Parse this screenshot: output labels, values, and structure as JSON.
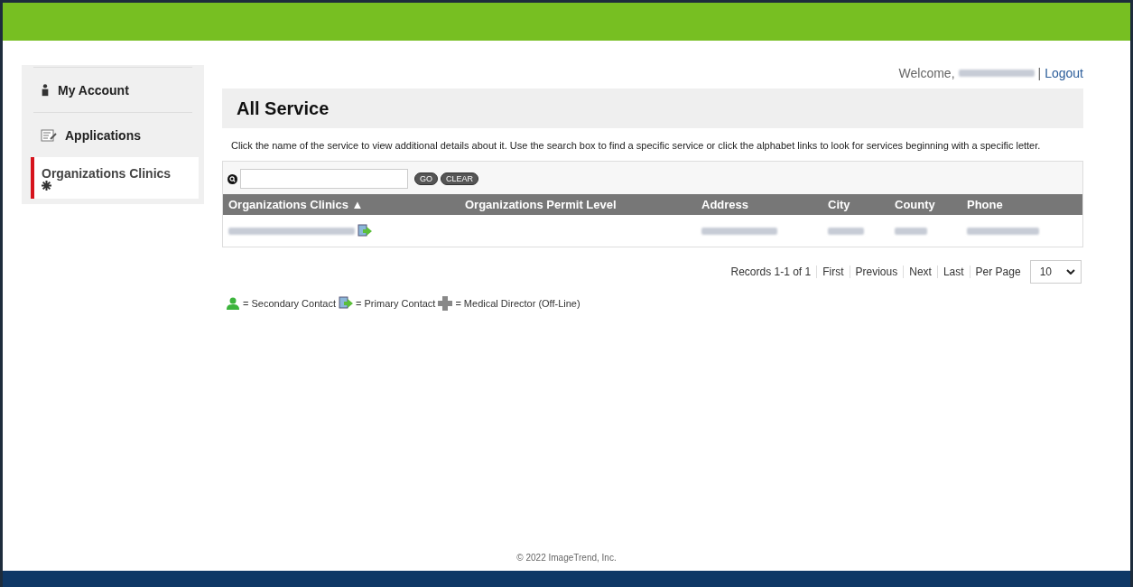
{
  "sidebar": {
    "items": [
      {
        "label": "My Account",
        "kind": "person",
        "selected": false
      },
      {
        "label": "Applications",
        "kind": "form",
        "selected": false
      },
      {
        "label": "Organizations Clinics",
        "kind": "asterisk",
        "selected": true
      }
    ]
  },
  "header": {
    "welcome": "Welcome,",
    "separator": "|",
    "logout": "Logout"
  },
  "page": {
    "title": "All Service",
    "description": "Click the name of the service to view additional details about it. Use the search box to find a specific service or click the alphabet links to look for services beginning with a specific letter."
  },
  "search": {
    "go": "GO",
    "clear": "CLEAR"
  },
  "table": {
    "columns": [
      {
        "label": "Organizations Clinics ▲"
      },
      {
        "label": "Organizations Permit Level"
      },
      {
        "label": "Address"
      },
      {
        "label": "City"
      },
      {
        "label": "County"
      },
      {
        "label": "Phone"
      }
    ],
    "rows": [
      {
        "primary_contact": true
      }
    ]
  },
  "pager": {
    "records": "Records 1-1 of 1",
    "links": [
      "First",
      "Previous",
      "Next",
      "Last"
    ],
    "per_page_label": "Per Page",
    "per_page": "10"
  },
  "legend": [
    {
      "kind": "person",
      "text": "= Secondary Contact"
    },
    {
      "kind": "arrow",
      "text": "= Primary Contact"
    },
    {
      "kind": "cross",
      "text": "= Medical Director (Off-Line)"
    }
  ],
  "footer": {
    "copyright": "© 2022 ImageTrend, Inc."
  }
}
